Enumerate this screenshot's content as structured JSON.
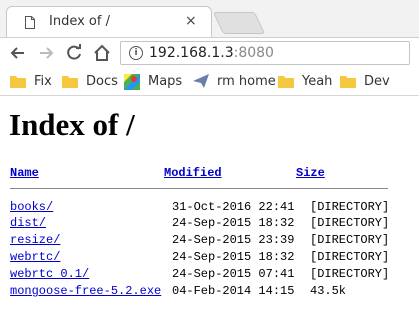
{
  "browser": {
    "tab_title": "Index of /",
    "tab_close": "×",
    "url_host": "192.168.1.3",
    "url_port": ":8080"
  },
  "bookmarks": [
    {
      "label": "Fix",
      "icon": "folder-icon"
    },
    {
      "label": "Docs",
      "icon": "folder-icon"
    },
    {
      "label": "Maps",
      "icon": "maps-icon"
    },
    {
      "label": "rm home",
      "icon": "send-icon"
    },
    {
      "label": "Yeah",
      "icon": "folder-icon"
    },
    {
      "label": "Dev",
      "icon": "folder-icon"
    }
  ],
  "page": {
    "title": "Index of /",
    "columns": {
      "name": "Name",
      "modified": "Modified",
      "size": "Size"
    },
    "rows": [
      {
        "name": "books/",
        "modified": "31-Oct-2016 22:41",
        "size": "[DIRECTORY]"
      },
      {
        "name": "dist/",
        "modified": "24-Sep-2015 18:32",
        "size": "[DIRECTORY]"
      },
      {
        "name": "resize/",
        "modified": "24-Sep-2015 23:39",
        "size": "[DIRECTORY]"
      },
      {
        "name": "webrtc/",
        "modified": "24-Sep-2015 18:32",
        "size": "[DIRECTORY]"
      },
      {
        "name": "webrtc 0.1/",
        "modified": "24-Sep-2015 07:41",
        "size": "[DIRECTORY]"
      },
      {
        "name": "mongoose-free-5.2.exe",
        "modified": "04-Feb-2014 14:15",
        "size": "43.5k"
      }
    ]
  },
  "colors": {
    "link": "#0000cc",
    "folder": "#f5c842"
  }
}
